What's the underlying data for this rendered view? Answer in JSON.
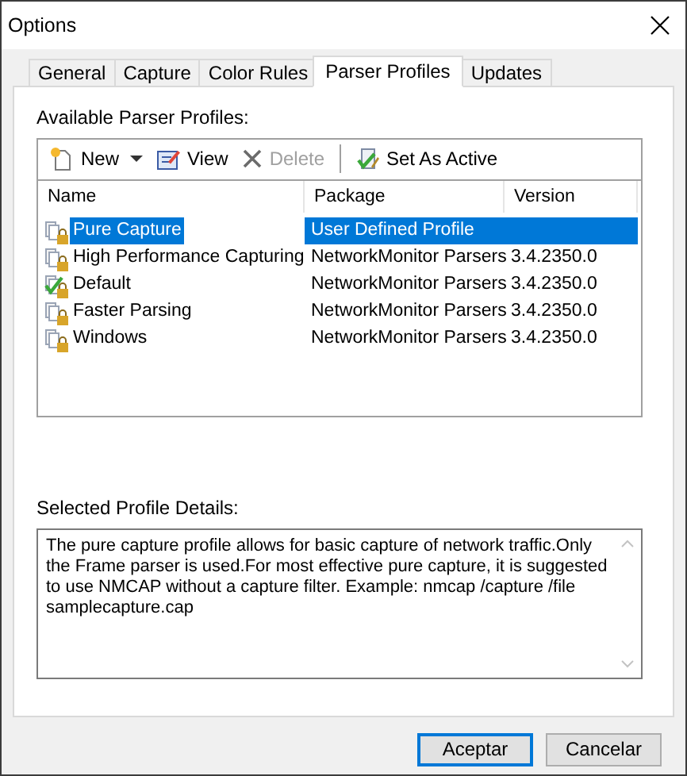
{
  "window": {
    "title": "Options"
  },
  "tabs": [
    {
      "label": "General",
      "selected": false
    },
    {
      "label": "Capture",
      "selected": false
    },
    {
      "label": "Color Rules",
      "selected": false
    },
    {
      "label": "Parser Profiles",
      "selected": true
    },
    {
      "label": "Updates",
      "selected": false
    }
  ],
  "profiles_label": "Available Parser Profiles:",
  "toolbar": [
    {
      "kind": "dropdown",
      "label": "New",
      "disabled": false
    },
    {
      "kind": "button",
      "label": "View",
      "disabled": false
    },
    {
      "kind": "button",
      "label": "Delete",
      "disabled": true
    },
    {
      "kind": "separator"
    },
    {
      "kind": "button",
      "label": "Set As Active",
      "disabled": false
    }
  ],
  "table": {
    "columns": [
      "Name",
      "Package",
      "Version"
    ],
    "rows": [
      {
        "name": "Pure Capture",
        "package": "User Defined Profile",
        "selected": true,
        "active": false
      },
      {
        "name": "High Performance Capturing",
        "package": "NetworkMonitor Parsers",
        "version": "3.4.2350.0",
        "selected": false,
        "active": false
      },
      {
        "name": "Default",
        "package": "NetworkMonitor Parsers",
        "version": "3.4.2350.0",
        "selected": false,
        "active": true
      },
      {
        "name": "Faster Parsing",
        "package": "NetworkMonitor Parsers",
        "version": "3.4.2350.0",
        "selected": false,
        "active": false
      },
      {
        "name": "Windows",
        "package": "NetworkMonitor Parsers",
        "version": "3.4.2350.0",
        "selected": false,
        "active": false
      }
    ]
  },
  "details_label": "Selected Profile Details:",
  "details": "The pure capture profile allows for basic capture of network traffic.Only the Frame parser is used.For most effective pure capture, it is suggested to use NMCAP without a capture filter.  Example:  nmcap /capture /file samplecapture.cap",
  "buttons": [
    {
      "label": "Aceptar",
      "default": true
    },
    {
      "label": "Cancelar",
      "default": false
    }
  ]
}
